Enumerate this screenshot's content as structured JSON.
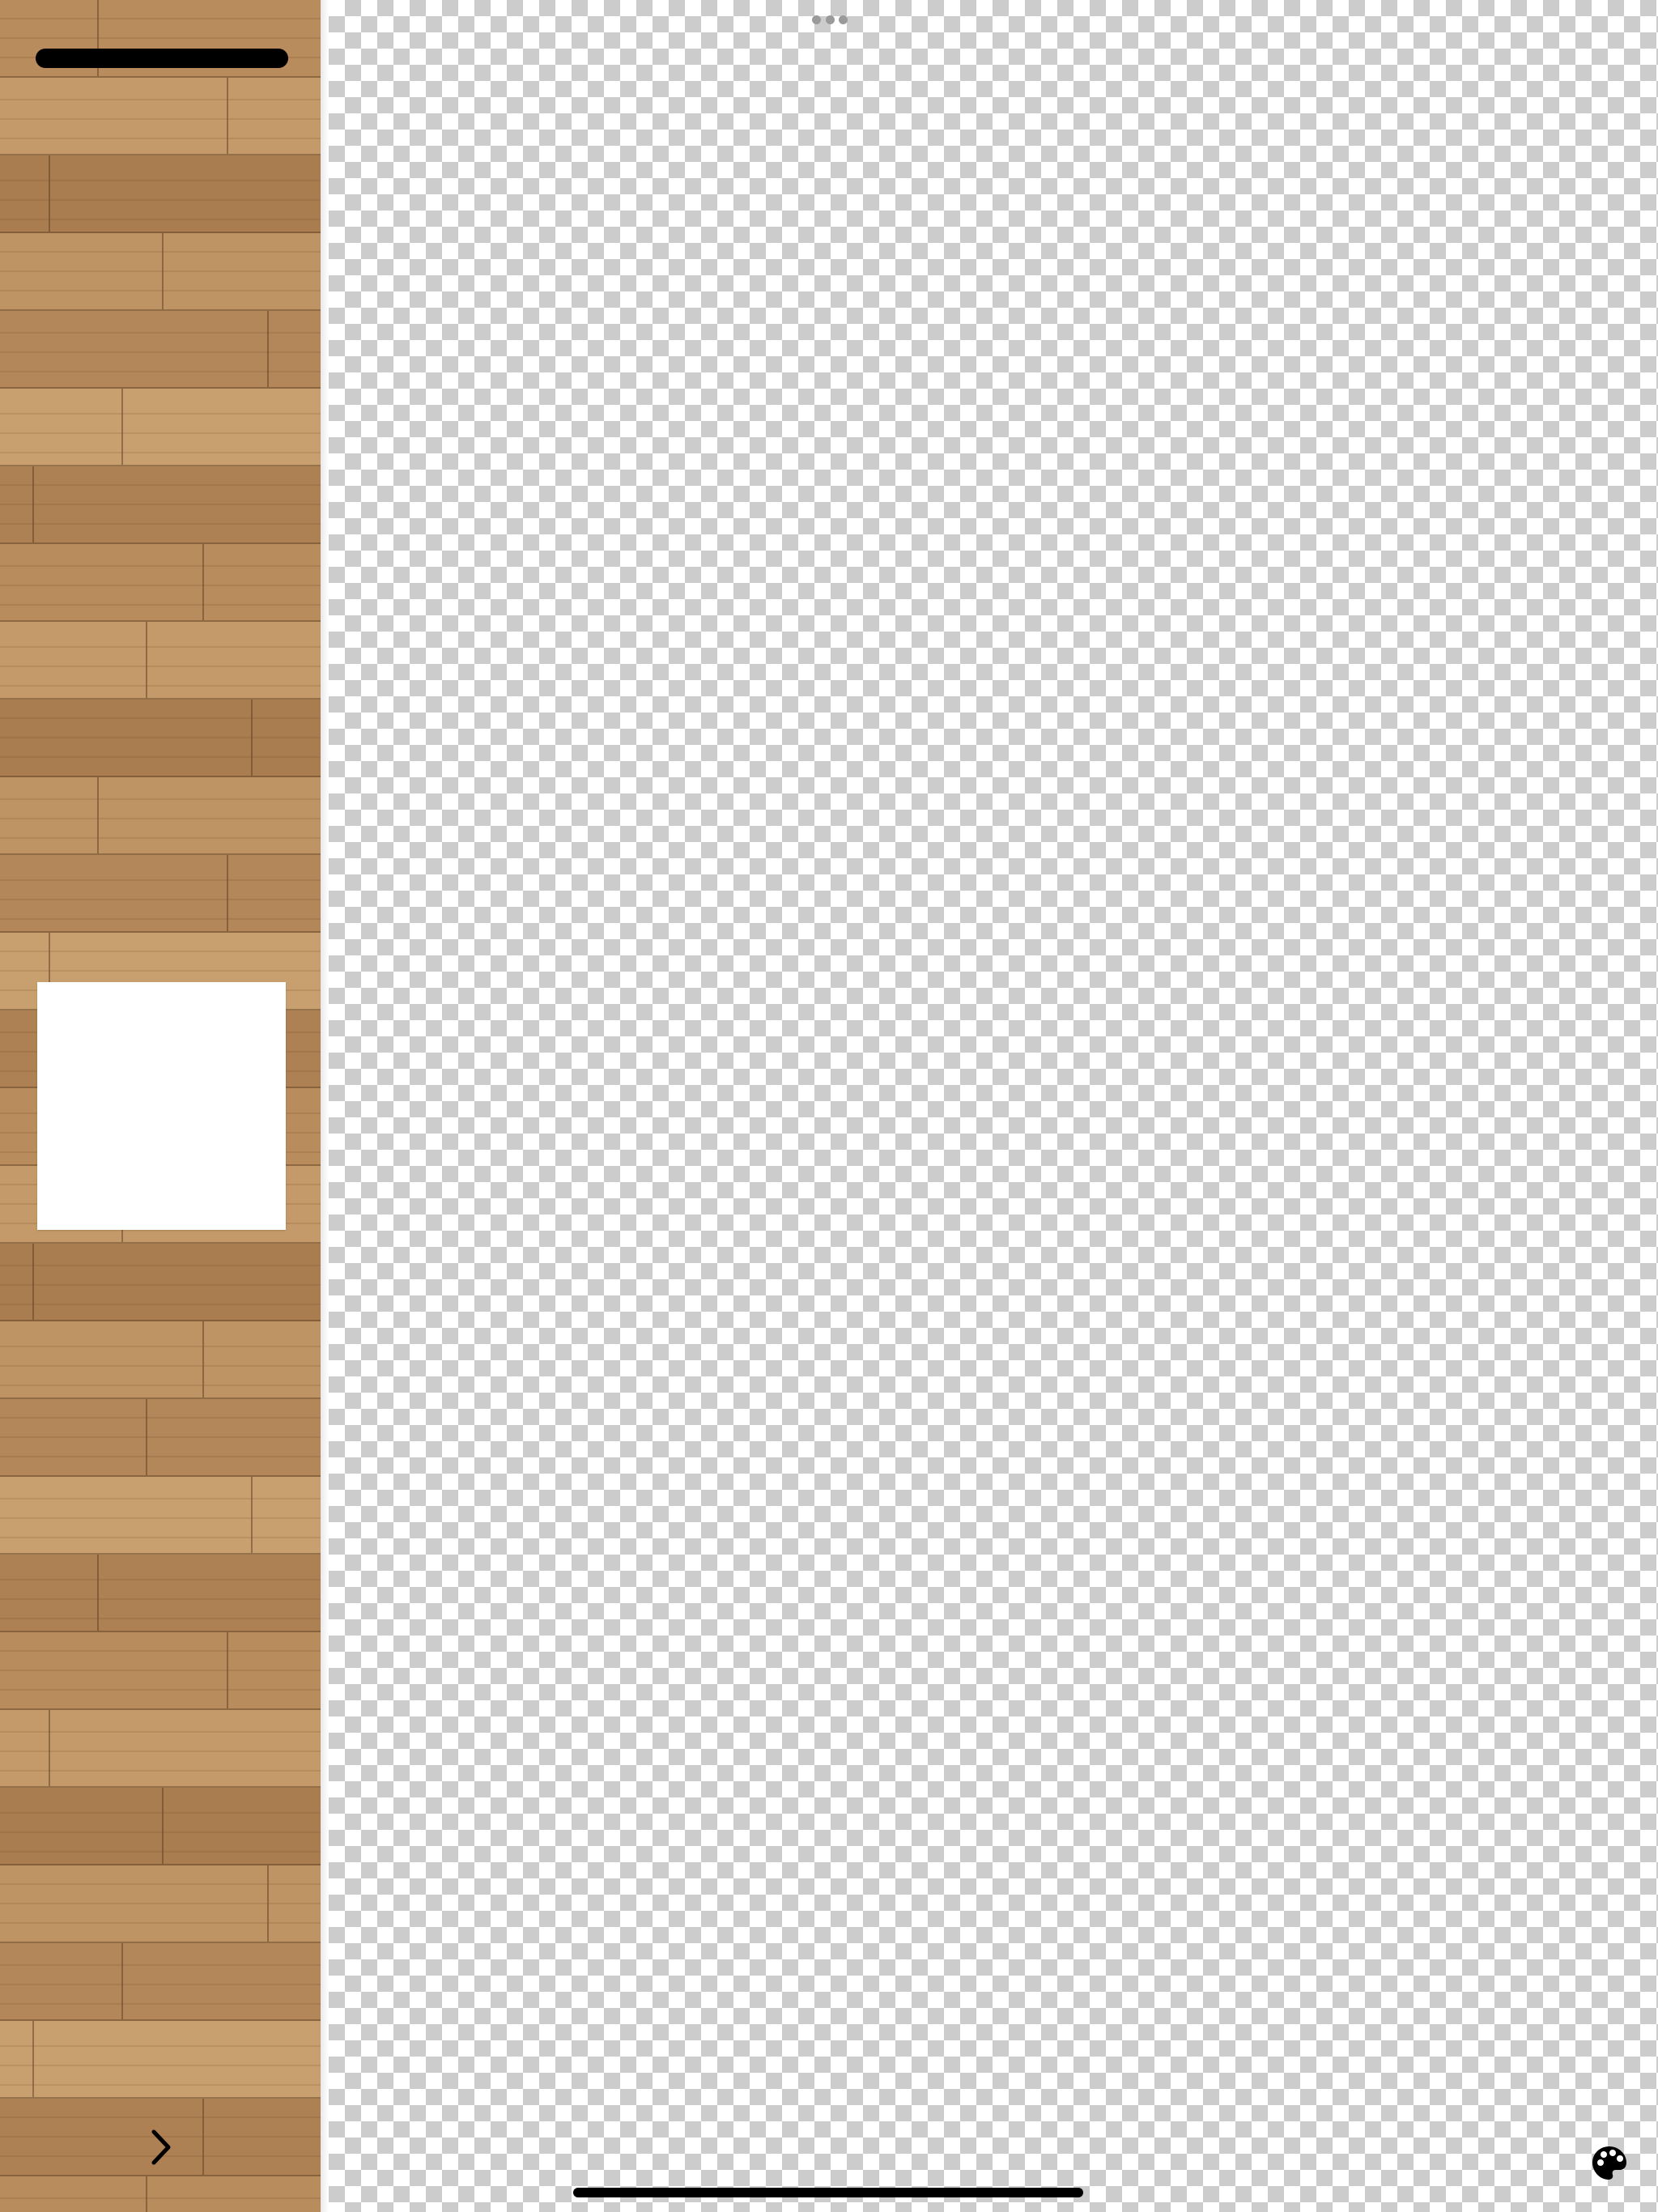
{
  "app": {
    "accent": "#000000",
    "sidebar_texture": "wood-planks",
    "sidebar_color": "#b88b5c",
    "canvas_background": "transparency-checkerboard"
  },
  "sidebar": {
    "handle_icon": "drag-handle-icon",
    "pages": [
      {
        "thumbnail_color": "#ffffff"
      }
    ],
    "expand_icon": "chevron-right-icon"
  },
  "toolbar": {
    "multitasking_icon": "ellipsis-icon",
    "palette_icon": "palette-icon"
  },
  "system": {
    "home_indicator": "home-indicator"
  }
}
